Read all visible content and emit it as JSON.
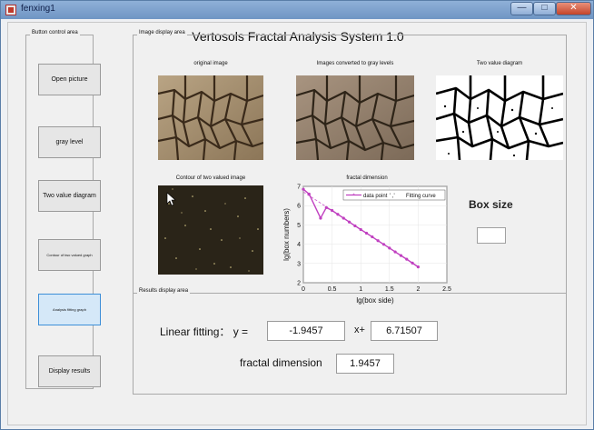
{
  "window": {
    "title": "fenxing1"
  },
  "app_title": "Vertosols  Fractal  Analysis  System  1.0",
  "button_area": {
    "title": "Button control area",
    "buttons": [
      "Open picture",
      "gray level",
      "Two value diagram",
      "Contour of two valued graph",
      "Analysis fitting graph",
      "Display results"
    ]
  },
  "image_area": {
    "title": "Image display area",
    "captions": [
      "original image",
      "Images converted to gray levels",
      "Two value diagram",
      "Contour of two valued image",
      "fractal dimension"
    ],
    "box_size_label": "Box size"
  },
  "results": {
    "title": "Results display area",
    "linear_label": "Linear fitting：  y   =",
    "slope": "-1.9457",
    "x_plus": "x+",
    "intercept": "6.71507",
    "fd_label": "fractal dimension",
    "fd_value": "1.9457"
  },
  "chart_data": {
    "type": "line",
    "title": "fractal dimension",
    "xlabel": "lg(box  side)",
    "ylabel": "lg(box numbers)",
    "xlim": [
      0,
      2.5
    ],
    "ylim": [
      2,
      7
    ],
    "xticks": [
      "0",
      "0.5",
      "1",
      "1.5",
      "2",
      "2.5"
    ],
    "yticks": [
      "2",
      "3",
      "4",
      "5",
      "6",
      "7"
    ],
    "legend": {
      "data_label": "data point",
      "fit_label": "Fitting curve",
      "sep": "'  ,'",
      "position": "top-right"
    },
    "series": [
      {
        "name": "data point",
        "x": [
          0,
          0.1,
          0.3,
          0.4,
          0.5,
          0.6,
          0.7,
          0.8,
          0.9,
          1.0,
          1.1,
          1.2,
          1.3,
          1.4,
          1.5,
          1.6,
          1.7,
          1.8,
          1.9,
          2.0
        ],
        "y": [
          6.85,
          6.6,
          5.35,
          5.9,
          5.75,
          5.55,
          5.35,
          5.15,
          4.95,
          4.76,
          4.57,
          4.38,
          4.18,
          3.99,
          3.8,
          3.6,
          3.41,
          3.22,
          3.02,
          2.82
        ]
      },
      {
        "name": "Fitting curve",
        "x": [
          0,
          2.0
        ],
        "y": [
          6.715,
          2.824
        ]
      }
    ],
    "colors": {
      "data": "#c040c0",
      "fit": "#d070d0"
    }
  }
}
